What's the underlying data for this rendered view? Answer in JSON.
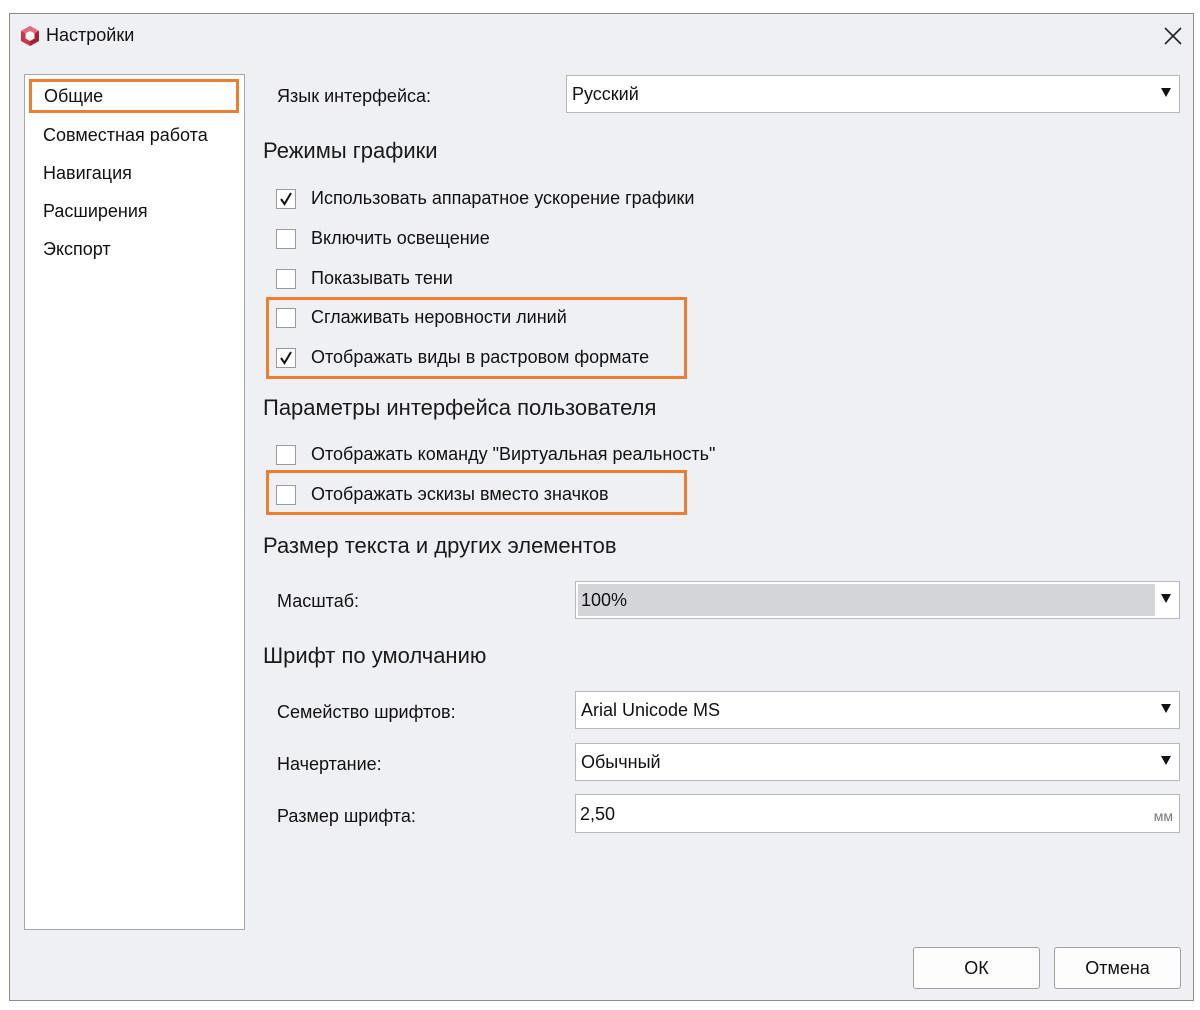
{
  "window": {
    "title": "Настройки"
  },
  "sidebar": {
    "items": [
      {
        "label": "Общие"
      },
      {
        "label": "Совместная работа"
      },
      {
        "label": "Навигация"
      },
      {
        "label": "Расширения"
      },
      {
        "label": "Экспорт"
      }
    ],
    "selected": "Общие"
  },
  "language": {
    "label": "Язык интерфейса:",
    "value": "Русский"
  },
  "graphics": {
    "title": "Режимы графики",
    "options": [
      {
        "label": "Использовать аппаратное ускорение графики",
        "checked": true
      },
      {
        "label": "Включить освещение",
        "checked": false
      },
      {
        "label": "Показывать тени",
        "checked": false
      },
      {
        "label": "Сглаживать неровности линий",
        "checked": false
      },
      {
        "label": "Отображать виды в растровом формате",
        "checked": true
      }
    ]
  },
  "ui_params": {
    "title": "Параметры интерфейса пользователя",
    "options": [
      {
        "label": "Отображать команду \"Виртуальная реальность\"",
        "checked": false
      },
      {
        "label": "Отображать эскизы вместо значков",
        "checked": false
      }
    ]
  },
  "text_size": {
    "title": "Размер текста и других элементов",
    "scale_label": "Масштаб:",
    "scale_value": "100%"
  },
  "font": {
    "title": "Шрифт по умолчанию",
    "family_label": "Семейство шрифтов:",
    "family_value": "Arial Unicode MS",
    "style_label": "Начертание:",
    "style_value": "Обычный",
    "size_label": "Размер шрифта:",
    "size_value": "2,50",
    "size_unit": "мм"
  },
  "buttons": {
    "ok": "ОК",
    "cancel": "Отмена"
  },
  "colors": {
    "highlight": "#ee7d2e",
    "background": "#eef0f3"
  }
}
